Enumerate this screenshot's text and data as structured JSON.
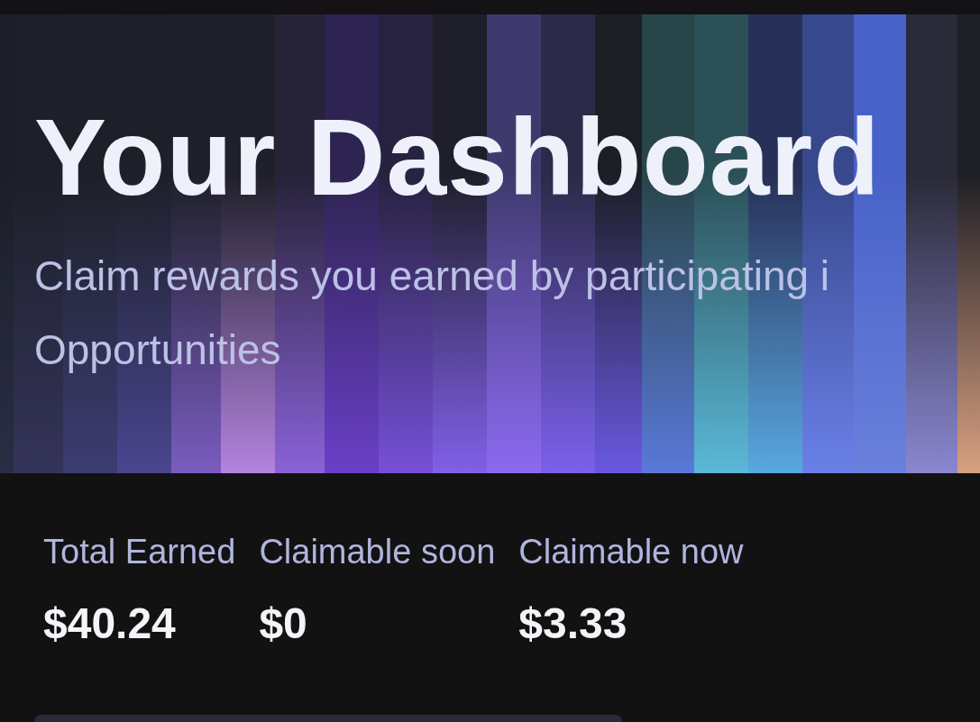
{
  "header": {
    "title": "Your Dashboard",
    "subtitle_lines": [
      "Claim rewards you earned by participating i",
      "Opportunities"
    ]
  },
  "stats": [
    {
      "label": "Total Earned",
      "value": "$40.24"
    },
    {
      "label": "Claimable soon",
      "value": "$0"
    },
    {
      "label": "Claimable now",
      "value": "$3.33"
    }
  ]
}
